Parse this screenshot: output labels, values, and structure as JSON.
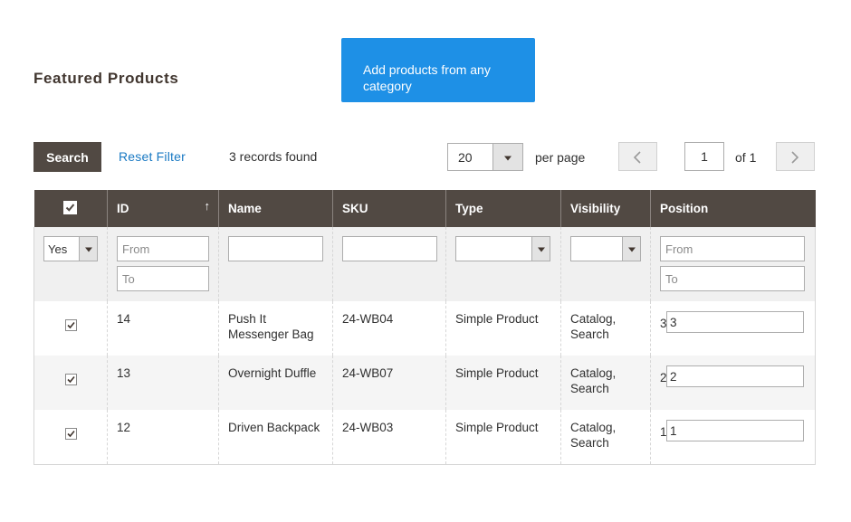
{
  "page": {
    "title": "Featured Products",
    "add_button": "Add products from any category"
  },
  "toolbar": {
    "search": "Search",
    "reset_filter": "Reset Filter",
    "records_found": "3 records found",
    "per_page_value": "20",
    "per_page_label": "per page",
    "current_page": "1",
    "of_pages": "of 1"
  },
  "grid": {
    "columns": [
      "ID",
      "Name",
      "SKU",
      "Type",
      "Visibility",
      "Position"
    ],
    "filters": {
      "in_products": "Yes",
      "id_from_placeholder": "From",
      "id_to_placeholder": "To",
      "name": "",
      "sku": "",
      "type": "",
      "visibility": "",
      "position_from_placeholder": "From",
      "position_to_placeholder": "To"
    },
    "rows": [
      {
        "checked": true,
        "id": "14",
        "name": "Push It Messenger Bag",
        "sku": "24-WB04",
        "type": "Simple Product",
        "visibility": "Catalog, Search",
        "position_text": "3",
        "position_value": "3"
      },
      {
        "checked": true,
        "id": "13",
        "name": "Overnight Duffle",
        "sku": "24-WB07",
        "type": "Simple Product",
        "visibility": "Catalog, Search",
        "position_text": "2",
        "position_value": "2"
      },
      {
        "checked": true,
        "id": "12",
        "name": "Driven Backpack",
        "sku": "24-WB03",
        "type": "Simple Product",
        "visibility": "Catalog, Search",
        "position_text": "1",
        "position_value": "1"
      }
    ]
  },
  "icons": {
    "sort": "arrow-up-icon",
    "prev": "chevron-left-icon",
    "next": "chevron-right-icon",
    "dropdown": "caret-down-icon",
    "checkbox": "checkmark-icon"
  },
  "colors": {
    "header_bg": "#514943",
    "accent_blue": "#1e90e6",
    "link": "#1979c3"
  }
}
